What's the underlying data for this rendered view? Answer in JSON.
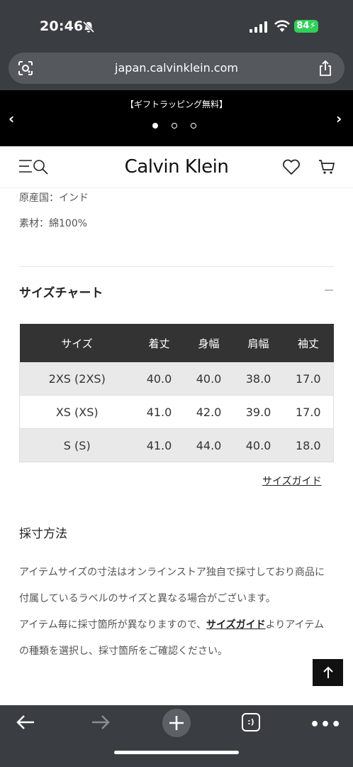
{
  "status_bar": {
    "time": "20:46",
    "battery": "84"
  },
  "browser": {
    "url": "japan.calvinklein.com"
  },
  "promo": {
    "text": "【ギフトラッピング無料】"
  },
  "site": {
    "logo": "Calvin Klein"
  },
  "product_specs": {
    "origin": "原産国：インド",
    "material": "素材：綿100%"
  },
  "size_chart": {
    "title": "サイズチャート",
    "columns": [
      "サイズ",
      "着丈",
      "身幅",
      "肩幅",
      "袖丈"
    ],
    "rows": [
      [
        "2XS (2XS)",
        "40.0",
        "40.0",
        "38.0",
        "17.0"
      ],
      [
        "XS (XS)",
        "41.0",
        "42.0",
        "39.0",
        "17.0"
      ],
      [
        "S (S)",
        "41.0",
        "44.0",
        "40.0",
        "18.0"
      ]
    ],
    "guide_link": "サイズガイド"
  },
  "measurement": {
    "title": "採寸方法",
    "paragraph1": "アイテムサイズの寸法はオンラインストア独自で採寸しており商品に付属しているラベルのサイズと異なる場合がございます。",
    "paragraph2_before": "アイテム毎に採寸箇所が異なりますので、",
    "paragraph2_link": "サイズガイド",
    "paragraph2_after": "よりアイテムの種類を選択し、採寸箇所をご確認ください。"
  },
  "icons": {
    "bell": "bell-slash-icon",
    "signal": "signal-icon",
    "wifi": "wifi-icon",
    "lens": "lens-icon",
    "share": "share-icon",
    "menu_search": "menu-search-icon",
    "heart": "heart-icon",
    "cart": "cart-icon",
    "back": "back-arrow-icon",
    "forward": "forward-arrow-icon",
    "new_tab": "plus-icon",
    "tabs": "tabs-icon",
    "more": "more-icon",
    "scroll_top": "arrow-up-icon"
  },
  "toolbar": {
    "tabs_label": ":)",
    "more_label": "•••"
  },
  "colors": {
    "chrome": "#3a3d41",
    "table_header": "#333333",
    "battery": "#2fd158"
  }
}
